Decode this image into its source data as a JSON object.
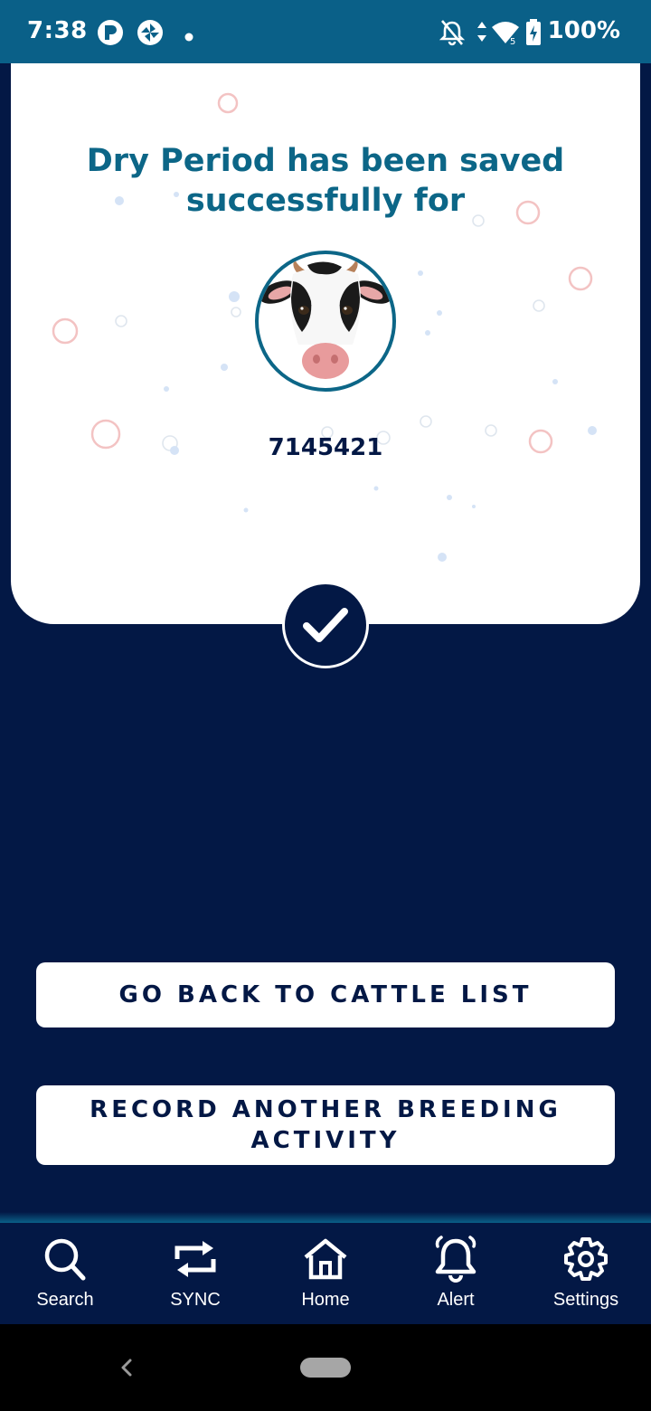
{
  "status_bar": {
    "time": "7:38",
    "battery": "100%",
    "left_icons": [
      "app-icon-p",
      "app-icon-shutter",
      "dot"
    ],
    "right_icons": [
      "bell-off-icon",
      "data-arrows-icon",
      "wifi-icon",
      "battery-charging-icon"
    ]
  },
  "card": {
    "title": "Dry Period has been saved successfully for",
    "cattle_id": "7145421",
    "avatar_icon": "cow-face-icon",
    "success_icon": "check-icon"
  },
  "actions": {
    "back_label": "GO BACK TO CATTLE LIST",
    "record_label": "RECORD ANOTHER BREEDING ACTIVITY"
  },
  "bottom_nav": {
    "items": [
      {
        "label": "Search",
        "icon": "search-icon"
      },
      {
        "label": "SYNC",
        "icon": "sync-icon"
      },
      {
        "label": "Home",
        "icon": "home-icon"
      },
      {
        "label": "Alert",
        "icon": "bell-icon"
      },
      {
        "label": "Settings",
        "icon": "gear-icon"
      }
    ]
  },
  "colors": {
    "background": "#031845",
    "status_bar": "#0a6088",
    "title": "#0c6687",
    "card": "#ffffff"
  }
}
